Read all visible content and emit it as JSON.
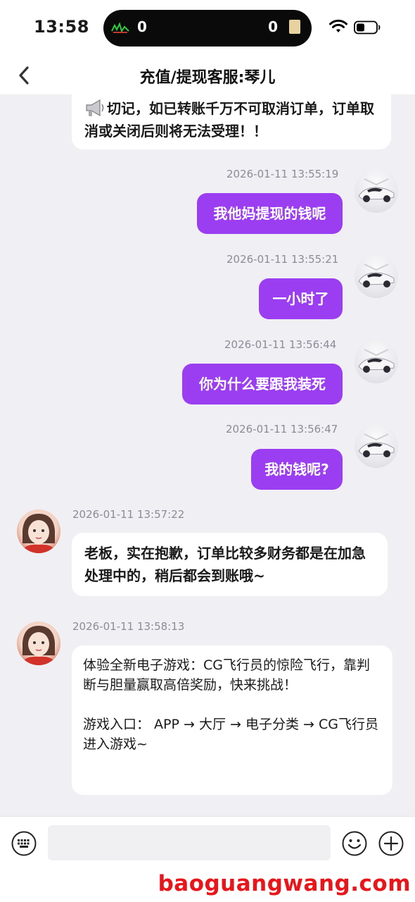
{
  "status_bar": {
    "time": "13:58",
    "island_left_value": "0",
    "island_right_value": "0"
  },
  "nav": {
    "title": "充值/提现客服:琴儿"
  },
  "messages": [
    {
      "id": "notice",
      "direction": "incoming",
      "text": "切记，如已转账千万不可取消订单，订单取消或关闭后则将无法受理！！",
      "icon": "megaphone-icon"
    },
    {
      "id": "m1",
      "direction": "outgoing",
      "timestamp": "2026-01-11 13:55:19",
      "text": "我他妈提现的钱呢"
    },
    {
      "id": "m2",
      "direction": "outgoing",
      "timestamp": "2026-01-11 13:55:21",
      "text": "一小时了"
    },
    {
      "id": "m3",
      "direction": "outgoing",
      "timestamp": "2026-01-11 13:56:44",
      "text": "你为什么要跟我装死"
    },
    {
      "id": "m4",
      "direction": "outgoing",
      "timestamp": "2026-01-11 13:56:47",
      "text": "我的钱呢?"
    },
    {
      "id": "m5",
      "direction": "incoming",
      "timestamp": "2026-01-11 13:57:22",
      "text": "老板，实在抱歉，订单比较多财务都是在加急处理中的，稍后都会到账哦~"
    },
    {
      "id": "m6",
      "direction": "incoming",
      "timestamp": "2026-01-11 13:58:13",
      "text": "体验全新电子游戏：CG飞行员的惊险飞行，靠判断与胆量赢取高倍奖励，快来挑战！\n\n游戏入口： APP → 大厅 → 电子分类 → CG飞行员 进入游戏~"
    }
  ],
  "input": {
    "placeholder": ""
  },
  "watermark": "baoguangwang.com",
  "colors": {
    "outgoing_bubble": "#9b3df0",
    "chat_background": "#efeff4",
    "watermark": "#e8161a"
  }
}
